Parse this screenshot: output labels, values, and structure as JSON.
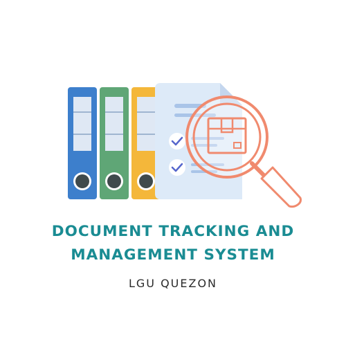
{
  "logo": {
    "title_line1": "DOCUMENT TRACKING AND",
    "title_line2": "MANAGEMENT SYSTEM",
    "subtitle": "LGU QUEZON",
    "colors": {
      "title": "#1a8c93",
      "binder_blue": "#3d7fcc",
      "binder_green": "#5fa676",
      "binder_yellow": "#f4b73a",
      "document": "#ddeaf8",
      "magnifier": "#f08a6e",
      "checkmark": "#5566cc"
    },
    "icons": [
      "binder-icon",
      "document-icon",
      "checkmark-icon",
      "package-box-icon",
      "magnifying-glass-icon"
    ]
  }
}
